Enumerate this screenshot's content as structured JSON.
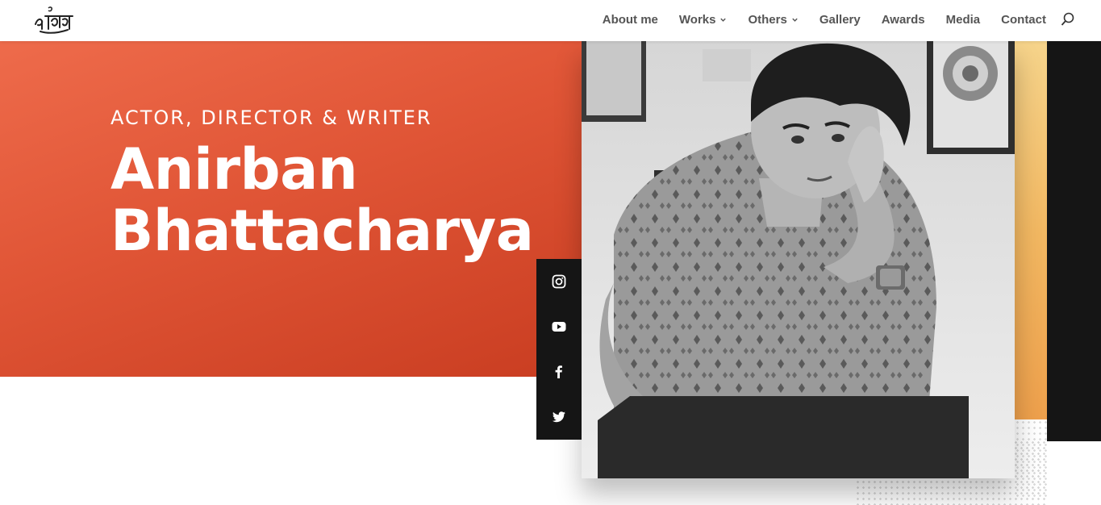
{
  "header": {
    "nav": [
      {
        "label": "About me",
        "has_dropdown": false
      },
      {
        "label": "Works",
        "has_dropdown": true
      },
      {
        "label": "Others",
        "has_dropdown": true
      },
      {
        "label": "Gallery",
        "has_dropdown": false
      },
      {
        "label": "Awards",
        "has_dropdown": false
      },
      {
        "label": "Media",
        "has_dropdown": false
      },
      {
        "label": "Contact",
        "has_dropdown": false
      }
    ],
    "icons": {
      "logo": "signature-logo",
      "search": "search-icon"
    }
  },
  "hero": {
    "subtitle": "ACTOR, DIRECTOR & WRITER",
    "name_line1": "Anirban",
    "name_line2": "Bhattacharya"
  },
  "social": [
    {
      "icon": "instagram-icon"
    },
    {
      "icon": "youtube-icon"
    },
    {
      "icon": "facebook-icon"
    },
    {
      "icon": "twitter-icon"
    }
  ],
  "colors": {
    "hero_orange": "#e05536",
    "accent_gold": "#f2b862",
    "dark": "#151515",
    "nav_text": "#555555"
  }
}
